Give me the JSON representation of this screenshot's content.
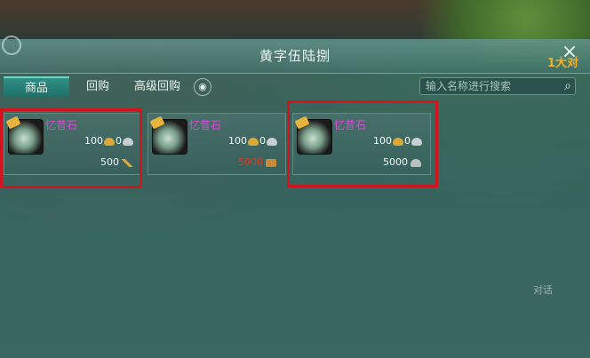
{
  "window": {
    "title": "黄字伍陆捌",
    "close_label": "×",
    "corner_text": "1大对"
  },
  "tabs": [
    {
      "label": "商品",
      "active": true
    },
    {
      "label": "回购",
      "active": false
    },
    {
      "label": "高级回购",
      "active": false
    }
  ],
  "eye_icon": "eye-icon",
  "search": {
    "placeholder": "输入名称进行搜索",
    "value": "",
    "icon": "search-icon"
  },
  "items": [
    {
      "name": "忆昔石",
      "count_gold": "100",
      "count_silver": "0",
      "price": "500",
      "currency_icon": "brush-icon",
      "price_color": "#f2f6f4",
      "highlighted": true
    },
    {
      "name": "忆昔石",
      "count_gold": "100",
      "count_silver": "0",
      "price": "5000",
      "currency_icon": "chest-icon",
      "price_color": "#e23a22",
      "highlighted": false
    },
    {
      "name": "忆昔石",
      "count_gold": "100",
      "count_silver": "0",
      "price": "5000",
      "currency_icon": "ingot-icon",
      "price_color": "#f2f6f4",
      "highlighted": true
    }
  ],
  "chat_hint": "对话",
  "colors": {
    "highlight": "#d1141e",
    "item_name": "#d84ed8",
    "accent": "#6fd6c6"
  }
}
